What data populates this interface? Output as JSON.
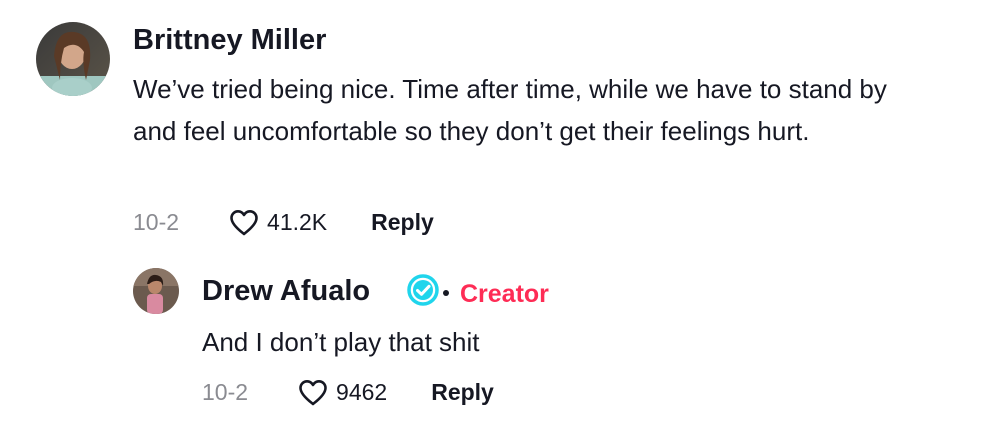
{
  "comment": {
    "username": "Brittney Miller",
    "text": "We’ve tried being nice. Time after time, while we have to stand by and feel uncomfortable so they don’t get their feelings hurt.",
    "date": "10-2",
    "likes": "41.2K",
    "reply_label": "Reply"
  },
  "reply": {
    "username": "Drew Afualo",
    "badge": "Creator",
    "text": "And I don’t play that shit",
    "date": "10-2",
    "likes": "9462",
    "reply_label": "Reply"
  },
  "colors": {
    "creator_badge": "#fe2c55",
    "verified": "#20d5ec",
    "muted_text": "#8a8b91",
    "primary_text": "#161823"
  },
  "icons": {
    "like": "heart-outline-icon",
    "verified": "verified-badge-icon"
  }
}
